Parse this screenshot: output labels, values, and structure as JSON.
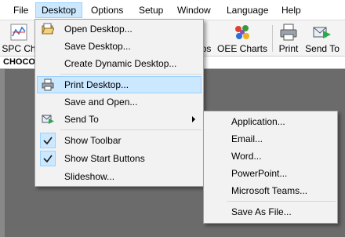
{
  "menubar": {
    "items": [
      {
        "label": "File"
      },
      {
        "label": "Desktop"
      },
      {
        "label": "Options"
      },
      {
        "label": "Setup"
      },
      {
        "label": "Window"
      },
      {
        "label": "Language"
      },
      {
        "label": "Help"
      }
    ],
    "active": "Desktop"
  },
  "toolbar": {
    "spc_label": "SPC Ch",
    "partial_label": "ps",
    "oee_label": "OEE Charts",
    "print_label": "Print",
    "sendto_label": "Send To"
  },
  "window_title": "CHOCO",
  "desktop_menu": {
    "items": [
      {
        "label": "Open Desktop...",
        "icon": "folder-open-icon"
      },
      {
        "label": "Save Desktop..."
      },
      {
        "label": "Create Dynamic Desktop..."
      },
      {
        "label": "Print Desktop...",
        "icon": "printer-icon",
        "highlighted": true
      },
      {
        "label": "Save and Open..."
      },
      {
        "label": "Send To",
        "icon": "send-icon",
        "has_submenu": true
      },
      {
        "label": "Show Toolbar",
        "checked": true
      },
      {
        "label": "Show Start Buttons",
        "checked": true
      },
      {
        "label": "Slideshow..."
      }
    ]
  },
  "send_to_menu": {
    "items": [
      {
        "label": "Application..."
      },
      {
        "label": "Email..."
      },
      {
        "label": "Word..."
      },
      {
        "label": "PowerPoint..."
      },
      {
        "label": "Microsoft Teams..."
      },
      {
        "label": "Save As File..."
      }
    ]
  },
  "colors": {
    "menu_highlight": "#cce8ff",
    "menu_highlight_border": "#99d1ff",
    "workspace": "#6b6b6b"
  }
}
